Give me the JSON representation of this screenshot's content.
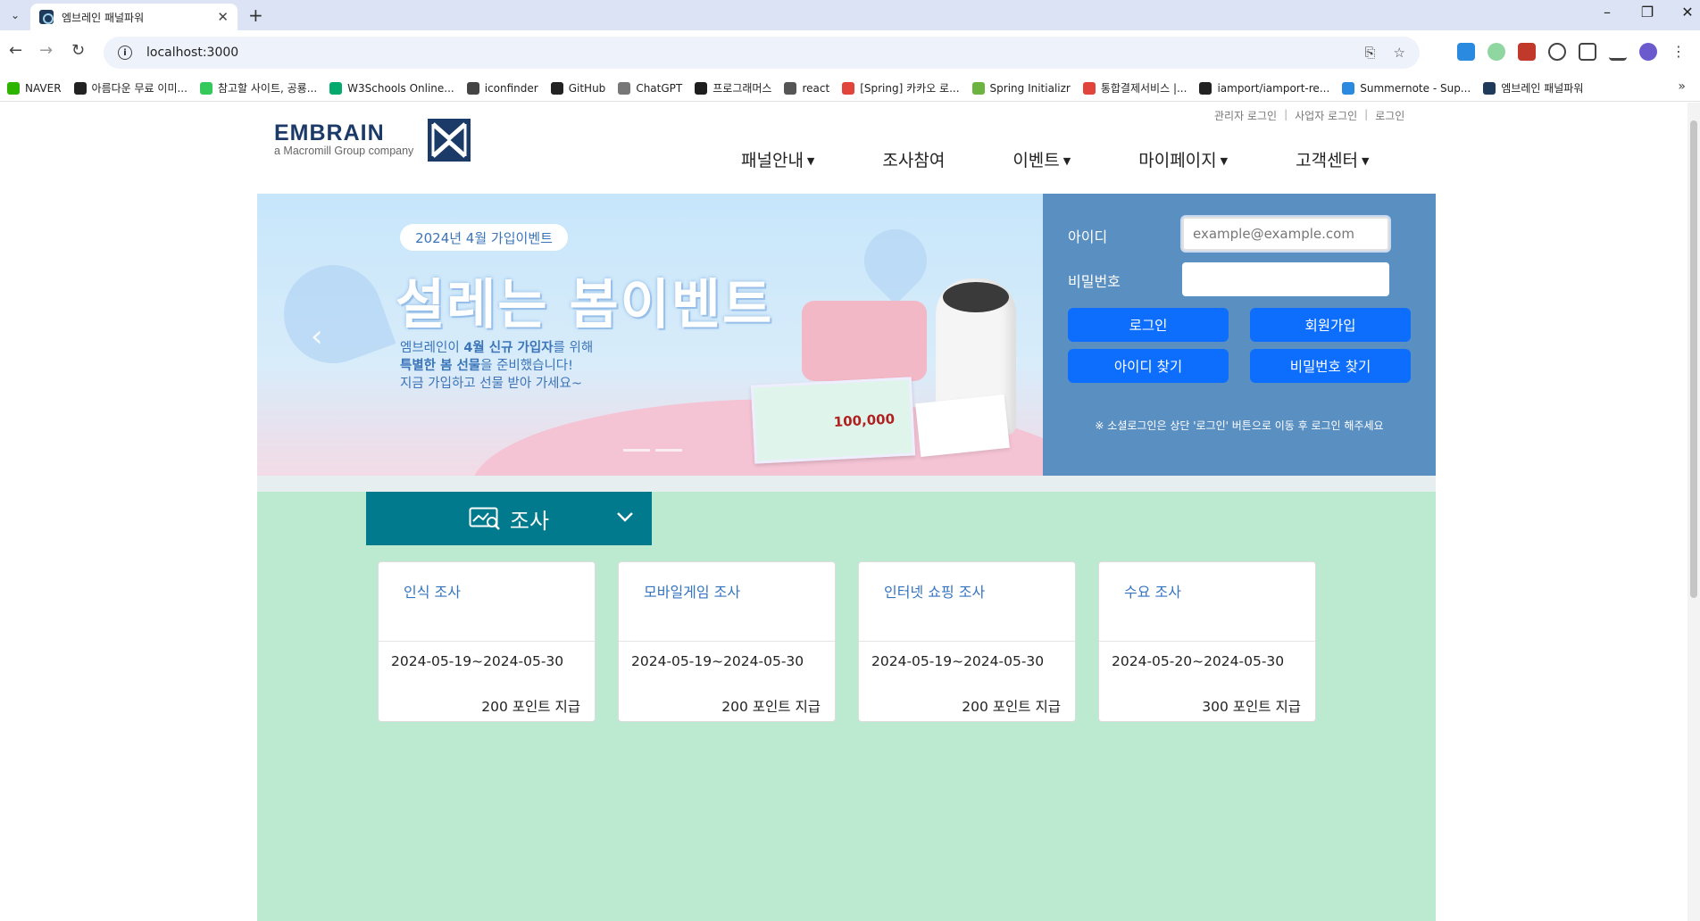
{
  "browser": {
    "tab_title": "엠브레인 패널파워",
    "url": "localhost:3000",
    "bookmarks": [
      "NAVER",
      "아름다운 무료 이미...",
      "참고할 사이트, 공룡...",
      "W3Schools Online...",
      "iconfinder",
      "GitHub",
      "ChatGPT",
      "프로그래머스",
      "react",
      "[Spring] 카카오 로...",
      "Spring Initializr",
      "통합결제서비스 |...",
      "iamport/iamport-re...",
      "Summernote - Sup...",
      "엠브레인 패널파워"
    ],
    "bookmark_colors": [
      "#2db400",
      "#222222",
      "#35c85a",
      "#04aa6d",
      "#444444",
      "#222222",
      "#777777",
      "#1e1e1e",
      "#555555",
      "#e0443a",
      "#6db33f",
      "#e0443a",
      "#222222",
      "#2a8ae0",
      "#1f3a5a"
    ]
  },
  "header": {
    "top_links": [
      "관리자 로그인",
      "사업자 로그인",
      "로그인"
    ],
    "logo_brand": "EMBRAIN",
    "logo_sub": "a Macromill Group company",
    "nav": [
      {
        "label": "패널안내",
        "dropdown": true
      },
      {
        "label": "조사참여",
        "dropdown": false
      },
      {
        "label": "이벤트",
        "dropdown": true
      },
      {
        "label": "마이페이지",
        "dropdown": true
      },
      {
        "label": "고객센터",
        "dropdown": true
      }
    ]
  },
  "banner": {
    "pill": "2024년 4월 가입이벤트",
    "headline": "설레는 봄이벤트",
    "desc_line1_a": "엠브레인이 ",
    "desc_line1_b": "4월 신규 가입자",
    "desc_line1_c": "를 위해",
    "desc_line2_a": "특별한 봄 선물",
    "desc_line2_b": "을 준비했습니다!",
    "desc_line3": "지금 가입하고 선물 받아 가세요~",
    "ticket_amount": "100,000"
  },
  "login": {
    "id_label": "아이디",
    "id_placeholder": "example@example.com",
    "pw_label": "비밀번호",
    "login_button": "로그인",
    "signup_button": "회원가입",
    "find_id_button": "아이디 찾기",
    "find_pw_button": "비밀번호 찾기",
    "note": "※ 소셜로그인은 상단 '로그인' 버튼으로 이동 후 로그인 해주세요"
  },
  "survey": {
    "section_title": "조사",
    "cards": [
      {
        "title": "인식 조사",
        "date": "2024-05-19~2024-05-30",
        "points": "200 포인트 지급"
      },
      {
        "title": "모바일게임 조사",
        "date": "2024-05-19~2024-05-30",
        "points": "200 포인트 지급"
      },
      {
        "title": "인터넷 쇼핑 조사",
        "date": "2024-05-19~2024-05-30",
        "points": "200 포인트 지급"
      },
      {
        "title": "수요 조사",
        "date": "2024-05-20~2024-05-30",
        "points": "300 포인트 지급"
      }
    ]
  },
  "colors": {
    "login_panel": "#5a8fc2",
    "primary_button": "#0d6efd",
    "survey_header": "#007a8c",
    "survey_section_bg": "#bbead1",
    "card_title": "#3474c2"
  }
}
